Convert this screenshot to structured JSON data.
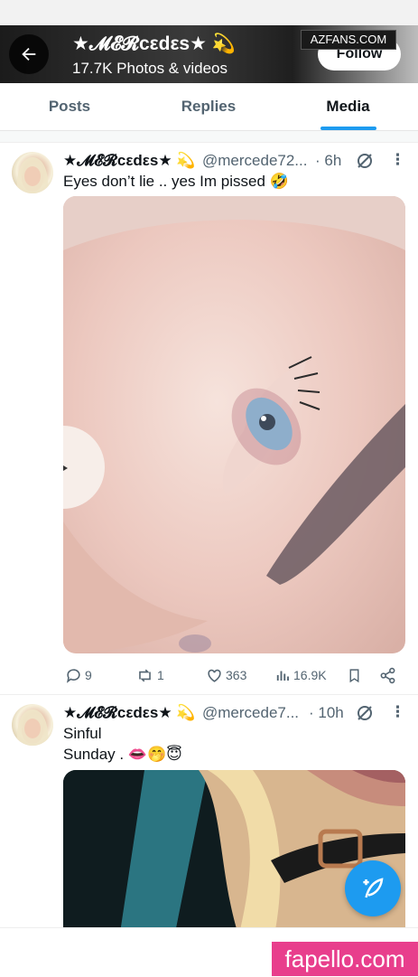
{
  "header": {
    "back_icon": "arrow-left-icon",
    "name": "★𝓜𝓔𝓡cεdεs★ 💫",
    "subtitle": "17.7K Photos & videos",
    "follow_label": "Follow",
    "watermark": "AZFANS.COM"
  },
  "tabs": [
    {
      "label": "Posts",
      "active": false
    },
    {
      "label": "Replies",
      "active": false
    },
    {
      "label": "Media",
      "active": true
    }
  ],
  "accent_color": "#1d9bf0",
  "posts": [
    {
      "name": "★𝓜𝓔𝓡cεdεs★ 💫",
      "handle": "@mercede72...",
      "time": "· 6h",
      "text_lines": [
        "Eyes don’t lie .. yes Im pissed 🤣"
      ],
      "actions": {
        "replies": "9",
        "reposts": "1",
        "likes": "363",
        "views": "16.9K"
      }
    },
    {
      "name": "★𝓜𝓔𝓡cεdεs★ 💫",
      "handle": "@mercede7...",
      "time": "· 10h",
      "text_lines": [
        "Sinful",
        "Sunday . 👄🤭😇"
      ]
    }
  ],
  "fab_icon": "compose-feather-icon",
  "watermark_bottom": "fapello.com"
}
